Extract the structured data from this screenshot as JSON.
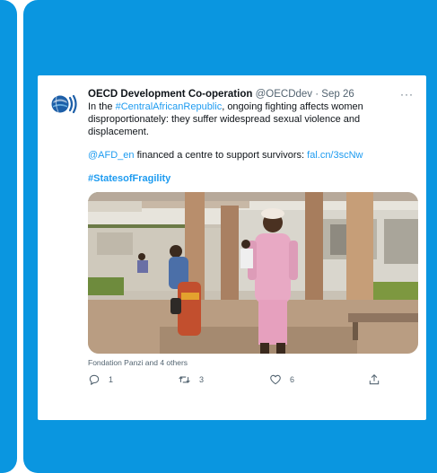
{
  "tweet": {
    "author_name": "OECD Development Co-operation",
    "handle": "@OECDdev",
    "separator": " · ",
    "date": "Sep 26",
    "more": "···",
    "text_part1": "In the ",
    "hashtag_car": "#CentralAfricanRepublic",
    "text_part2": ", ongoing fighting affects women disproportionately: they suffer widespread sexual violence and displacement.",
    "mention": "@AFD_en",
    "text_part3": " financed a centre to support survivors: ",
    "link": "fal.cn/3scNw",
    "hashtag_fragility": "#StatesofFragility",
    "tagged": "Fondation Panzi and 4 others",
    "actions": {
      "replies": "1",
      "retweets": "3",
      "likes": "6"
    }
  },
  "colors": {
    "background_blue": "#0a96e0",
    "link_blue": "#1d9bf0",
    "text": "#0f1419",
    "muted": "#536471"
  },
  "icons": {
    "avatar": "oecd-logo-icon",
    "reply": "reply-icon",
    "retweet": "retweet-icon",
    "like": "like-icon",
    "share": "share-icon"
  }
}
